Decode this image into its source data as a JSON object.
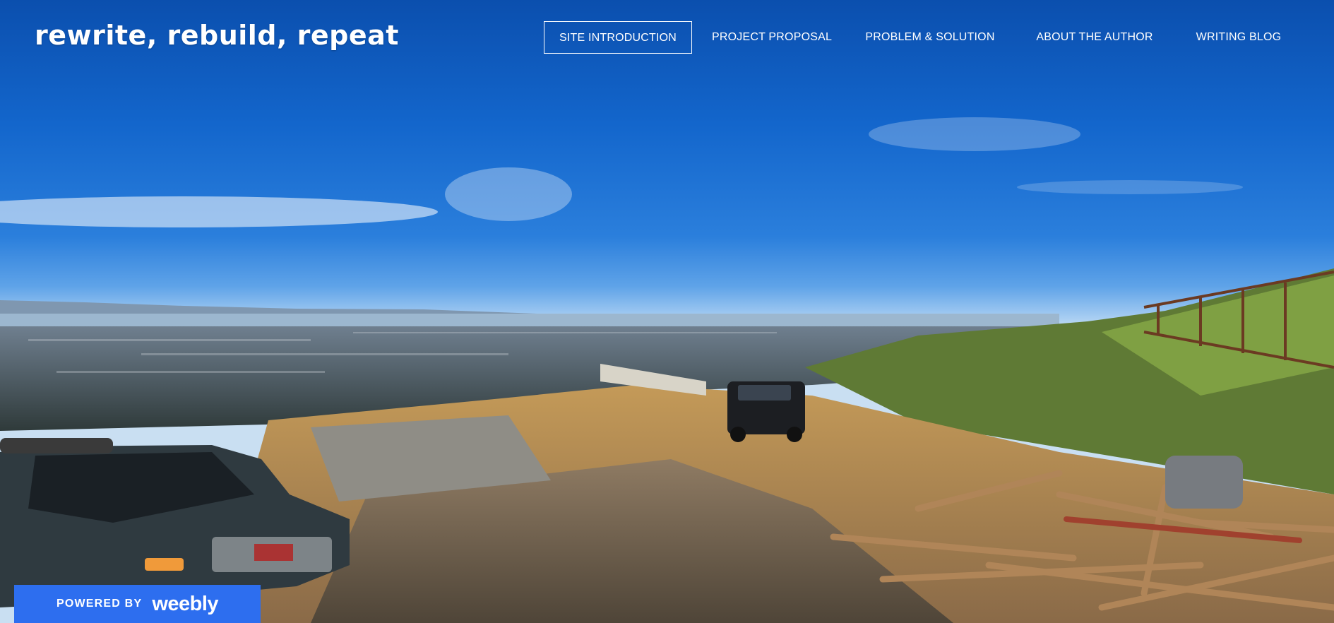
{
  "site": {
    "title": "rewrite, rebuild, repeat"
  },
  "nav": {
    "items": [
      {
        "label": "SITE INTRODUCTION",
        "active": true
      },
      {
        "label": "PROJECT PROPOSAL",
        "active": false
      },
      {
        "label": "PROBLEM & SOLUTION",
        "active": false
      },
      {
        "label": "ABOUT THE AUTHOR",
        "active": false
      },
      {
        "label": "WRITING BLOG",
        "active": false
      }
    ]
  },
  "badge": {
    "prefix": "POWERED BY",
    "brand": "weebly",
    "color": "#2d6eef"
  },
  "hero": {
    "alt": "panoramic hillside construction site overlooking a city and bay"
  }
}
